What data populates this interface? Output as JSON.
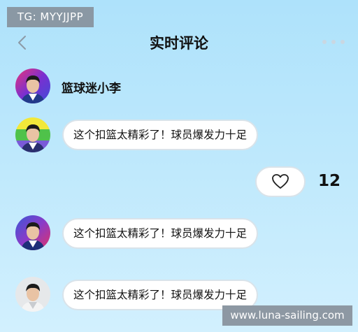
{
  "badge": {
    "text": "TG: MYYJJPP"
  },
  "header": {
    "title": "实时评论",
    "back_icon": "chevron-left-icon",
    "more_icon": "more-dots-icon"
  },
  "user": {
    "name": "篮球迷小李"
  },
  "comments": [
    {
      "text": "这个扣篮太精彩了！球员爆发力十足"
    },
    {
      "text": "这个扣篮太精彩了！球员爆发力十足"
    },
    {
      "text": "这个扣篮太精彩了！球员爆发力十足"
    }
  ],
  "like": {
    "icon": "heart-icon",
    "count": "12"
  },
  "watermark": {
    "text": "www.luna-sailing.com"
  },
  "colors": {
    "accent_bg": "#aee2fb",
    "bubble_border": "#d9e3ea",
    "badge_bg": "#8a98a4"
  }
}
